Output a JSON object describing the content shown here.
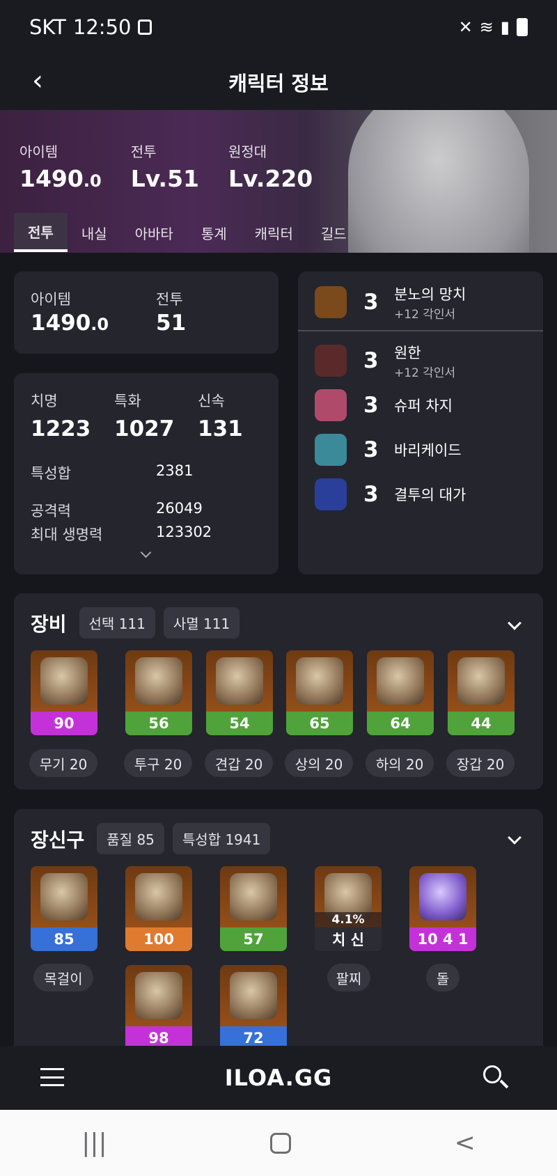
{
  "status_bar": {
    "carrier": "SKT",
    "time": "12:50",
    "icons": [
      "silent-icon",
      "wifi-icon",
      "signal-icon",
      "battery-icon"
    ]
  },
  "app_bar": {
    "title": "캐릭터 정보"
  },
  "hero": {
    "stats": [
      {
        "label": "아이템",
        "value": "1490",
        "decimal": ".0"
      },
      {
        "label": "전투",
        "value": "Lv.51",
        "decimal": ""
      },
      {
        "label": "원정대",
        "value": "Lv.220",
        "decimal": ""
      }
    ],
    "tabs": [
      "전투",
      "내실",
      "아바타",
      "통계",
      "캐릭터",
      "길드"
    ],
    "active_tab": "전투"
  },
  "summary_card": {
    "item_label": "아이템",
    "item_value": "1490",
    "item_decimal": ".0",
    "combat_label": "전투",
    "combat_value": "51"
  },
  "stat_card": {
    "stats": [
      {
        "label": "치명",
        "value": "1223"
      },
      {
        "label": "특화",
        "value": "1027"
      },
      {
        "label": "신속",
        "value": "131"
      }
    ],
    "trait_total_label": "특성합",
    "trait_total_value": "2381",
    "attack_label": "공격력",
    "attack_value": "26049",
    "hp_label": "최대 생명력",
    "hp_value": "123302"
  },
  "engravings": [
    {
      "level": "3",
      "name": "분노의 망치",
      "sub": "+12 각인서",
      "color": "#7a4a1c"
    },
    {
      "level": "3",
      "name": "원한",
      "sub": "+12 각인서",
      "color": "#5a2a2a"
    },
    {
      "level": "3",
      "name": "슈퍼 차지",
      "sub": "",
      "color": "#b04a6a"
    },
    {
      "level": "3",
      "name": "바리케이드",
      "sub": "",
      "color": "#3a8a9a"
    },
    {
      "level": "3",
      "name": "결투의 대가",
      "sub": "",
      "color": "#2a3f9a"
    }
  ],
  "equipment": {
    "title": "장비",
    "chips": [
      "선택 111",
      "사멸 111"
    ],
    "items": [
      {
        "quality": "90",
        "bar_color": "#c531d8",
        "label": "무기 20"
      },
      {
        "quality": "56",
        "bar_color": "#4fa33a",
        "label": "투구 20"
      },
      {
        "quality": "54",
        "bar_color": "#4fa33a",
        "label": "견갑 20"
      },
      {
        "quality": "65",
        "bar_color": "#4fa33a",
        "label": "상의 20"
      },
      {
        "quality": "64",
        "bar_color": "#4fa33a",
        "label": "하의 20"
      },
      {
        "quality": "44",
        "bar_color": "#4fa33a",
        "label": "장갑 20"
      }
    ]
  },
  "accessories": {
    "title": "장신구",
    "chips": [
      "품질 85",
      "특성합 1941"
    ],
    "row1": [
      {
        "quality": "85",
        "bar_color": "#3670d8",
        "label": "목걸이"
      },
      {
        "quality": "100",
        "bar_color": "#e07a2e",
        "label": ""
      },
      {
        "quality": "57",
        "bar_color": "#4fa33a",
        "label": ""
      },
      {
        "quality": "치 신",
        "bar_color": "#2c2c34",
        "label": "팔찌",
        "badge": "4.1%"
      },
      {
        "quality": "10 4 1",
        "bar_color": "#c531d8",
        "label": "돌"
      }
    ],
    "row2": [
      {
        "quality": "98",
        "bar_color": "#c531d8"
      },
      {
        "quality": "72",
        "bar_color": "#3670d8"
      }
    ]
  },
  "bottom_nav": {
    "logo": "ILOA.GG"
  },
  "system_nav": {
    "recent": "|||",
    "back": "<"
  }
}
